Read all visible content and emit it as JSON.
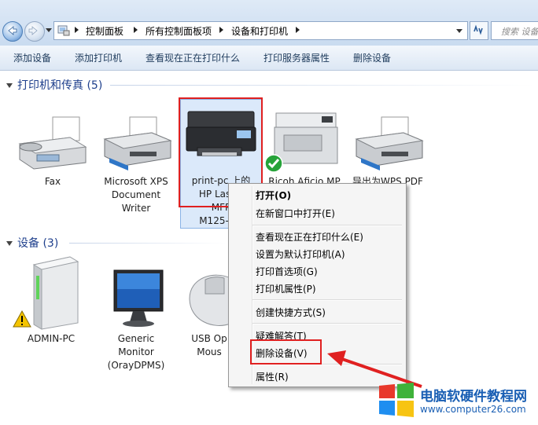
{
  "address_bar": {
    "breadcrumbs": [
      "控制面板",
      "所有控制面板项",
      "设备和打印机"
    ],
    "search_placeholder": "搜索 设备"
  },
  "command_bar": {
    "items": [
      "添加设备",
      "添加打印机",
      "查看现在正在打印什么",
      "打印服务器属性",
      "删除设备"
    ]
  },
  "groups": {
    "printers": {
      "header": "打印机和传真 (5)",
      "devices": [
        {
          "label": "Fax",
          "icon": "fax-icon"
        },
        {
          "label": "Microsoft XPS\nDocument\nWriter",
          "icon": "printer-icon"
        },
        {
          "label": "print-pc 上的\nHP LaserJ\nMFP\nM125-M1",
          "icon": "laser-mfp-printer-icon",
          "selected": true,
          "default_check": false
        },
        {
          "label": "Ricoh Aficio MP",
          "icon": "ricoh-printer-icon",
          "default_check": true
        },
        {
          "label": "导出为WPS PDF",
          "icon": "printer-icon"
        }
      ]
    },
    "devices": {
      "header": "设备 (3)",
      "devices": [
        {
          "label": "ADMIN-PC",
          "icon": "computer-tower-icon",
          "warning": true
        },
        {
          "label": "Generic\nMonitor\n(OrayDPMS)",
          "icon": "monitor-icon"
        },
        {
          "label": "USB Op\nMous",
          "icon": "mouse-icon"
        }
      ]
    }
  },
  "context_menu": {
    "items": [
      {
        "label": "打开(O)",
        "bold": true
      },
      {
        "label": "在新窗口中打开(E)"
      },
      {
        "label": "查看现在正在打印什么(E)"
      },
      {
        "label": "设置为默认打印机(A)"
      },
      {
        "label": "打印首选项(G)"
      },
      {
        "label": "打印机属性(P)"
      },
      {
        "label": "创建快捷方式(S)"
      },
      {
        "label": "疑难解答(T)"
      },
      {
        "label": "删除设备(V)",
        "highlighted": true
      },
      {
        "label": "属性(R)"
      }
    ]
  },
  "watermark": {
    "site_name": "电脑软硬件教程网",
    "url": "www.computer26.com"
  },
  "colors": {
    "highlight_red": "#e02020",
    "group_header": "#1e3f8c",
    "selection_fill": "#dbe9fa"
  }
}
